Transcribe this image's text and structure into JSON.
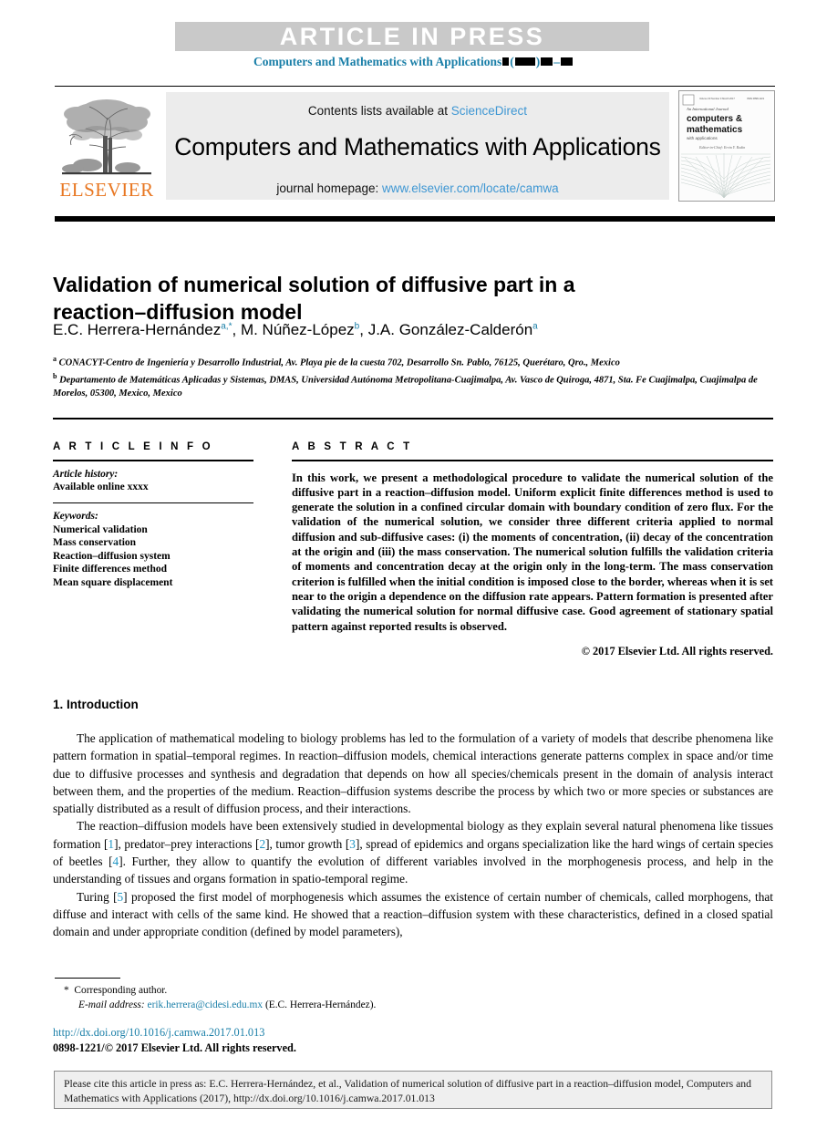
{
  "banner": {
    "text": "ARTICLE IN PRESS",
    "running_head_journal": "Computers and Mathematics with Applications"
  },
  "header": {
    "contents_prefix": "Contents lists available at",
    "sciencedirect": "ScienceDirect",
    "journal_title": "Computers and Mathematics with Applications",
    "homepage_prefix": "journal homepage:",
    "homepage_url": "www.elsevier.com/locate/camwa",
    "publisher": "ELSEVIER",
    "cover": {
      "line1": "An International Journal",
      "line2": "computers &",
      "line3": "mathematics",
      "line4": "with applications",
      "line5": "Editor-in-Chief: Ervin Y. Rodin"
    }
  },
  "article": {
    "title": "Validation of numerical solution of diffusive part in a reaction–diffusion model",
    "authors": "E.C. Herrera-Hernández a*, M. Núñez-López b, J.A. González-Calderón a",
    "author_list": [
      {
        "name": "E.C. Herrera-Hernández",
        "marks": "a,*"
      },
      {
        "name": "M. Núñez-López",
        "marks": "b"
      },
      {
        "name": "J.A. González-Calderón",
        "marks": "a"
      }
    ],
    "affiliations": [
      {
        "mark": "a",
        "text": "CONACYT-Centro de Ingeniería y Desarrollo Industrial, Av. Playa pie de la cuesta 702, Desarrollo Sn. Pablo, 76125, Querétaro, Qro., Mexico"
      },
      {
        "mark": "b",
        "text": "Departamento de Matemáticas Aplicadas y Sistemas, DMAS, Universidad Autónoma Metropolitana-Cuajimalpa, Av. Vasco de Quiroga, 4871, Sta. Fe Cuajimalpa, Cuajimalpa de Morelos, 05300, Mexico, Mexico"
      }
    ]
  },
  "info": {
    "heading": "A R T I C L E   I N F O",
    "history_label": "Article history:",
    "history_value": "Available online xxxx",
    "keywords_label": "Keywords:",
    "keywords": [
      "Numerical validation",
      "Mass conservation",
      "Reaction–diffusion system",
      "Finite differences method",
      "Mean square displacement"
    ]
  },
  "abstract": {
    "heading": "A B S T R A C T",
    "body": "In this work, we present a methodological procedure to validate the numerical solution of the diffusive part in a reaction–diffusion model. Uniform explicit finite differences method is used to generate the solution in a confined circular domain with boundary condition of zero flux. For the validation of the numerical solution, we consider three different criteria applied to normal diffusion and sub-diffusive cases: (i) the moments of concentration, (ii) decay of the concentration at the origin and (iii) the mass conservation. The numerical solution fulfills the validation criteria of moments and concentration decay at the origin only in the long-term. The mass conservation criterion is fulfilled when the initial condition is imposed close to the border, whereas when it is set near to the origin a dependence on the diffusion rate appears. Pattern formation is presented after validating the numerical solution for normal diffusive case. Good agreement of stationary spatial pattern against reported results is observed.",
    "copyright": "© 2017 Elsevier Ltd. All rights reserved."
  },
  "body": {
    "section_number_title": "1. Introduction",
    "paragraphs": [
      "The application of mathematical modeling to biology problems has led to the formulation of a variety of models that describe phenomena like pattern formation in spatial–temporal regimes. In reaction–diffusion models, chemical interactions generate patterns complex in space and/or time due to diffusive processes and synthesis and degradation that depends on how all species/chemicals present in the domain of analysis interact between them, and the properties of the medium. Reaction–diffusion systems describe the process by which two or more species or substances are spatially distributed as a result of diffusion process, and their interactions."
    ],
    "para2_parts": {
      "a": "The reaction–diffusion models have been extensively studied in developmental biology as they explain several natural phenomena like tissues formation [",
      "c1": "1",
      "b": "], predator–prey interactions [",
      "c2": "2",
      "c": "], tumor growth [",
      "c3": "3",
      "d": "], spread of epidemics and organs specialization like the hard wings of certain species of beetles [",
      "c4": "4",
      "e": "]. Further, they allow to quantify the evolution of different variables involved in the morphogenesis process, and help in the understanding of tissues and organs formation in spatio-temporal regime."
    },
    "para3_parts": {
      "a": "Turing [",
      "c5": "5",
      "b": "] proposed the first model of morphogenesis which assumes the existence of certain number of chemicals, called morphogens, that diffuse and interact with cells of the same kind. He showed that a reaction–diffusion system with these characteristics, defined in a closed spatial domain and under appropriate condition (defined by model parameters),"
    }
  },
  "footnotes": {
    "corresponding": "Corresponding author.",
    "email_label": "E-mail address:",
    "email": "erik.herrera@cidesi.edu.mx",
    "email_owner": "(E.C. Herrera-Hernández).",
    "doi": "http://dx.doi.org/10.1016/j.camwa.2017.01.013",
    "issn_copyright": "0898-1221/© 2017 Elsevier Ltd. All rights reserved."
  },
  "cite_box": {
    "text": "Please cite this article in press as: E.C. Herrera-Hernández, et al., Validation of numerical solution of diffusive part in a reaction–diffusion model, Computers and Mathematics with Applications (2017), http://dx.doi.org/10.1016/j.camwa.2017.01.013"
  },
  "colors": {
    "banner_bg": "#c9c9c9",
    "link_blue": "#3f97d3",
    "running_head_teal": "#1a7fa8",
    "elsevier_orange": "#e87722",
    "grey_box": "#ececec",
    "cite_box_bg": "#efefef"
  }
}
